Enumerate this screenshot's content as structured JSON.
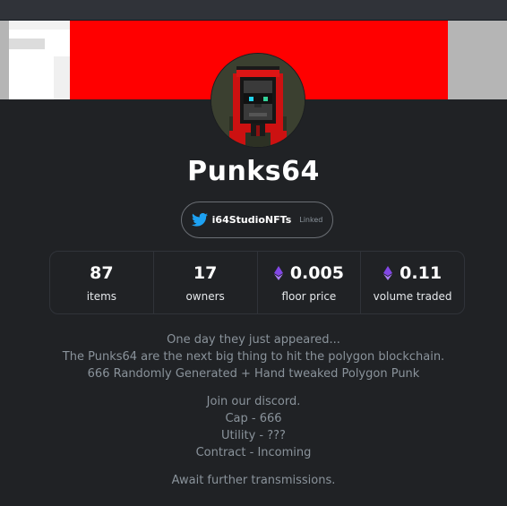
{
  "collection": {
    "name": "Punks64"
  },
  "social": {
    "handle": "i64StudioNFTs",
    "status": "Linked",
    "icon": "twitter-icon",
    "icon_color": "#1da1f2"
  },
  "stats": [
    {
      "value": "87",
      "label": "items",
      "icon": null
    },
    {
      "value": "17",
      "label": "owners",
      "icon": null
    },
    {
      "value": "0.005",
      "label": "floor price",
      "icon": "eth-icon"
    },
    {
      "value": "0.11",
      "label": "volume traded",
      "icon": "eth-icon"
    }
  ],
  "description": {
    "para1": [
      "One day they just appeared...",
      "The Punks64 are the next big thing to hit the polygon blockchain.",
      "666 Randomly Generated + Hand tweaked Polygon Punk"
    ],
    "para2": [
      "Join our discord.",
      "Cap - 666",
      "Utility - ???",
      "Contract - Incoming"
    ],
    "para3": [
      "Await further transmissions."
    ]
  },
  "colors": {
    "background": "#202225",
    "banner": "#ff0000",
    "eth_icon": "#8247e5"
  }
}
